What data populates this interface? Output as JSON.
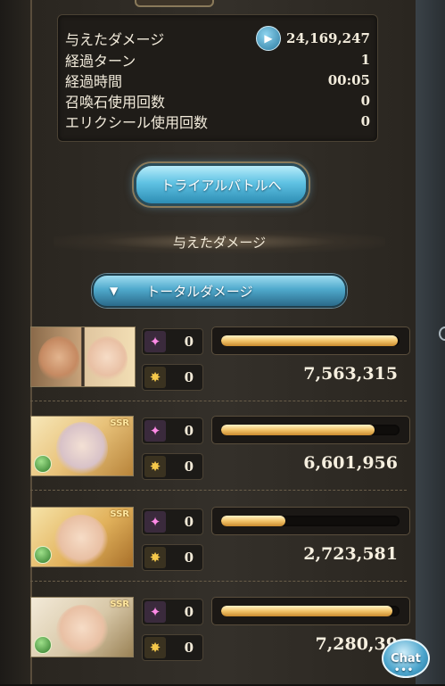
{
  "stats": [
    {
      "label": "与えたダメージ",
      "value": "24,169,247",
      "icon": "play-icon"
    },
    {
      "label": "経過ターン",
      "value": "1"
    },
    {
      "label": "経過時間",
      "value": "00:05"
    },
    {
      "label": "召喚石使用回数",
      "value": "0"
    },
    {
      "label": "エリクシール使用回数",
      "value": "0"
    }
  ],
  "trial_button": "トライアルバトルへ",
  "section_title": "与えたダメージ",
  "dropdown": {
    "label": "トータルダメージ",
    "icon": "triangle-down-icon"
  },
  "entries": [
    {
      "charge_attacks": "0",
      "ougi": "0",
      "damage": "7,563,315",
      "fill_fraction": 0.99,
      "portrait": "dual"
    },
    {
      "charge_attacks": "0",
      "ougi": "0",
      "damage": "6,601,956",
      "fill_fraction": 0.86,
      "portrait": "ssr",
      "rarity": "SSR"
    },
    {
      "charge_attacks": "0",
      "ougi": "0",
      "damage": "2,723,581",
      "fill_fraction": 0.36,
      "portrait": "ssr",
      "rarity": "SSR"
    },
    {
      "charge_attacks": "0",
      "ougi": "0",
      "damage": "7,280,39",
      "fill_fraction": 0.96,
      "portrait": "ssr",
      "rarity": "SSR"
    }
  ],
  "chat_button": "Chat",
  "colors": {
    "accent": "#4fa9cc",
    "bar": "#f2c46a",
    "panel": "#2f2b25"
  }
}
